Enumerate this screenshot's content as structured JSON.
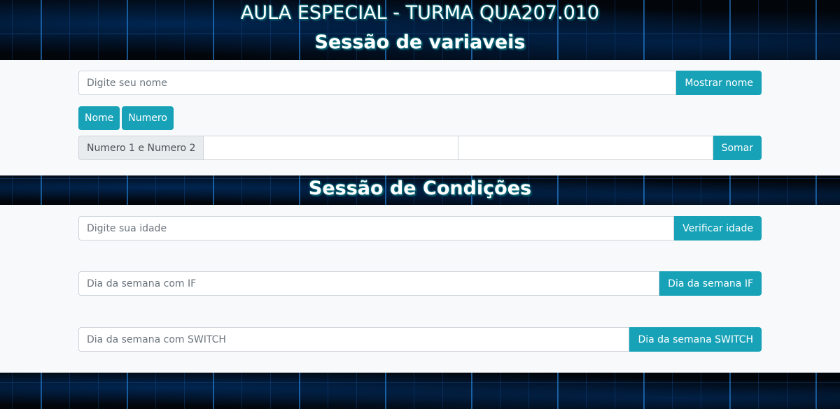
{
  "header": {
    "title": "AULA ESPECIAL - TURMA QUA207.010",
    "section_vars": "Sessão de variaveis"
  },
  "vars": {
    "name_input_placeholder": "Digite seu nome",
    "show_name_label": "Mostrar nome",
    "nome_label": "Nome",
    "numero_label": "Numero",
    "sum_prepend": "Numero 1 e Numero 2",
    "num1_value": "",
    "num2_value": "",
    "sum_label": "Somar"
  },
  "cond": {
    "section_title": "Sessão de Condições",
    "age_placeholder": "Digite sua idade",
    "age_button": "Verificar idade",
    "if_placeholder": "Dia da semana com IF",
    "if_button": "Dia da semana IF",
    "switch_placeholder": "Dia da semana com SWITCH",
    "switch_button": "Dia da semana SWITCH"
  },
  "colors": {
    "accent": "#17a2b8",
    "panel_bg": "#f8f9fa",
    "title_glow": "#0a7f8f"
  }
}
